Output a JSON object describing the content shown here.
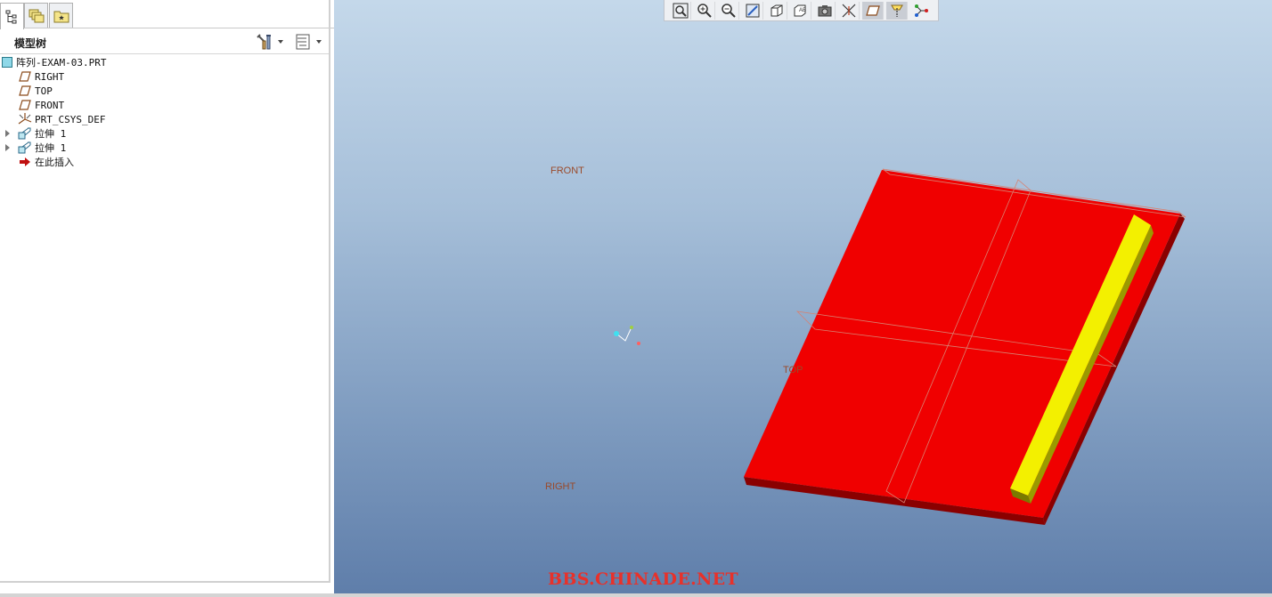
{
  "tabs": [
    {
      "name": "model-tree",
      "icon": "model-tree-icon"
    },
    {
      "name": "layers",
      "icon": "layers-icon"
    },
    {
      "name": "favorites",
      "icon": "favorites-icon"
    }
  ],
  "panel": {
    "title": "模型树",
    "settings_icon": "tools-icon",
    "show_icon": "list-settings-icon"
  },
  "tree": {
    "root": "阵列-EXAM-03.PRT",
    "items": [
      {
        "label": "RIGHT",
        "icon": "datum-plane-icon",
        "expandable": false
      },
      {
        "label": "TOP",
        "icon": "datum-plane-icon",
        "expandable": false
      },
      {
        "label": "FRONT",
        "icon": "datum-plane-icon",
        "expandable": false
      },
      {
        "label": "PRT_CSYS_DEF",
        "icon": "csys-icon",
        "expandable": false
      },
      {
        "label": "拉伸 1",
        "icon": "extrude-icon",
        "expandable": true
      },
      {
        "label": "拉伸 1",
        "icon": "extrude-icon",
        "expandable": true
      },
      {
        "label": "在此插入",
        "icon": "insert-arrow-icon",
        "expandable": false
      }
    ]
  },
  "view_toolbar": [
    "refit-icon",
    "zoom-in-icon",
    "zoom-out-icon",
    "repaint-icon",
    "display-style-icon",
    "saved-views-icon",
    "view-manager-icon",
    "datum-display-icon",
    "plane-display-icon",
    "axis-display-icon",
    "point-display-icon"
  ],
  "datum_labels": {
    "front": "FRONT",
    "top": "TOP",
    "right": "RIGHT"
  },
  "watermark": "BBS.CHINADE.NET",
  "colors": {
    "plate": "#f00000",
    "bar": "#f3f000",
    "viewport_top": "#c4d8ea",
    "viewport_bottom": "#5f7eaa",
    "datum_label": "#9a4a2a"
  }
}
